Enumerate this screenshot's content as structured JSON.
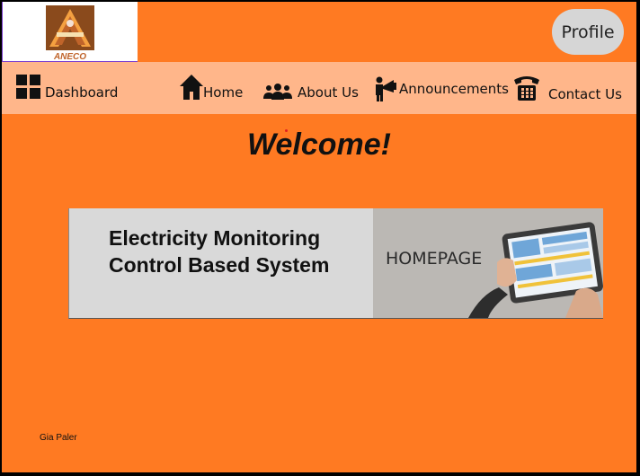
{
  "header": {
    "logo_alt": "ANECO",
    "profile_label": "Profile"
  },
  "nav": {
    "items": [
      {
        "label": "Dashboard",
        "icon": "grid-icon"
      },
      {
        "label": "Home",
        "icon": "home-icon"
      },
      {
        "label": "About Us",
        "icon": "users-icon"
      },
      {
        "label": "Announcements",
        "icon": "megaphone-icon"
      },
      {
        "label": "Contact Us",
        "icon": "telephone-icon"
      }
    ]
  },
  "main": {
    "welcome": "Welcome!",
    "banner_title": "Electricity Monitoring Control Based System",
    "banner_image_text": "HOMEPAGE"
  },
  "footer": {
    "author": "Gia Paler"
  },
  "colors": {
    "background": "#ff7a22",
    "navbar": "#ffb68a",
    "banner_panel": "#d9d9d9",
    "profile_button": "#d6d6d6"
  }
}
